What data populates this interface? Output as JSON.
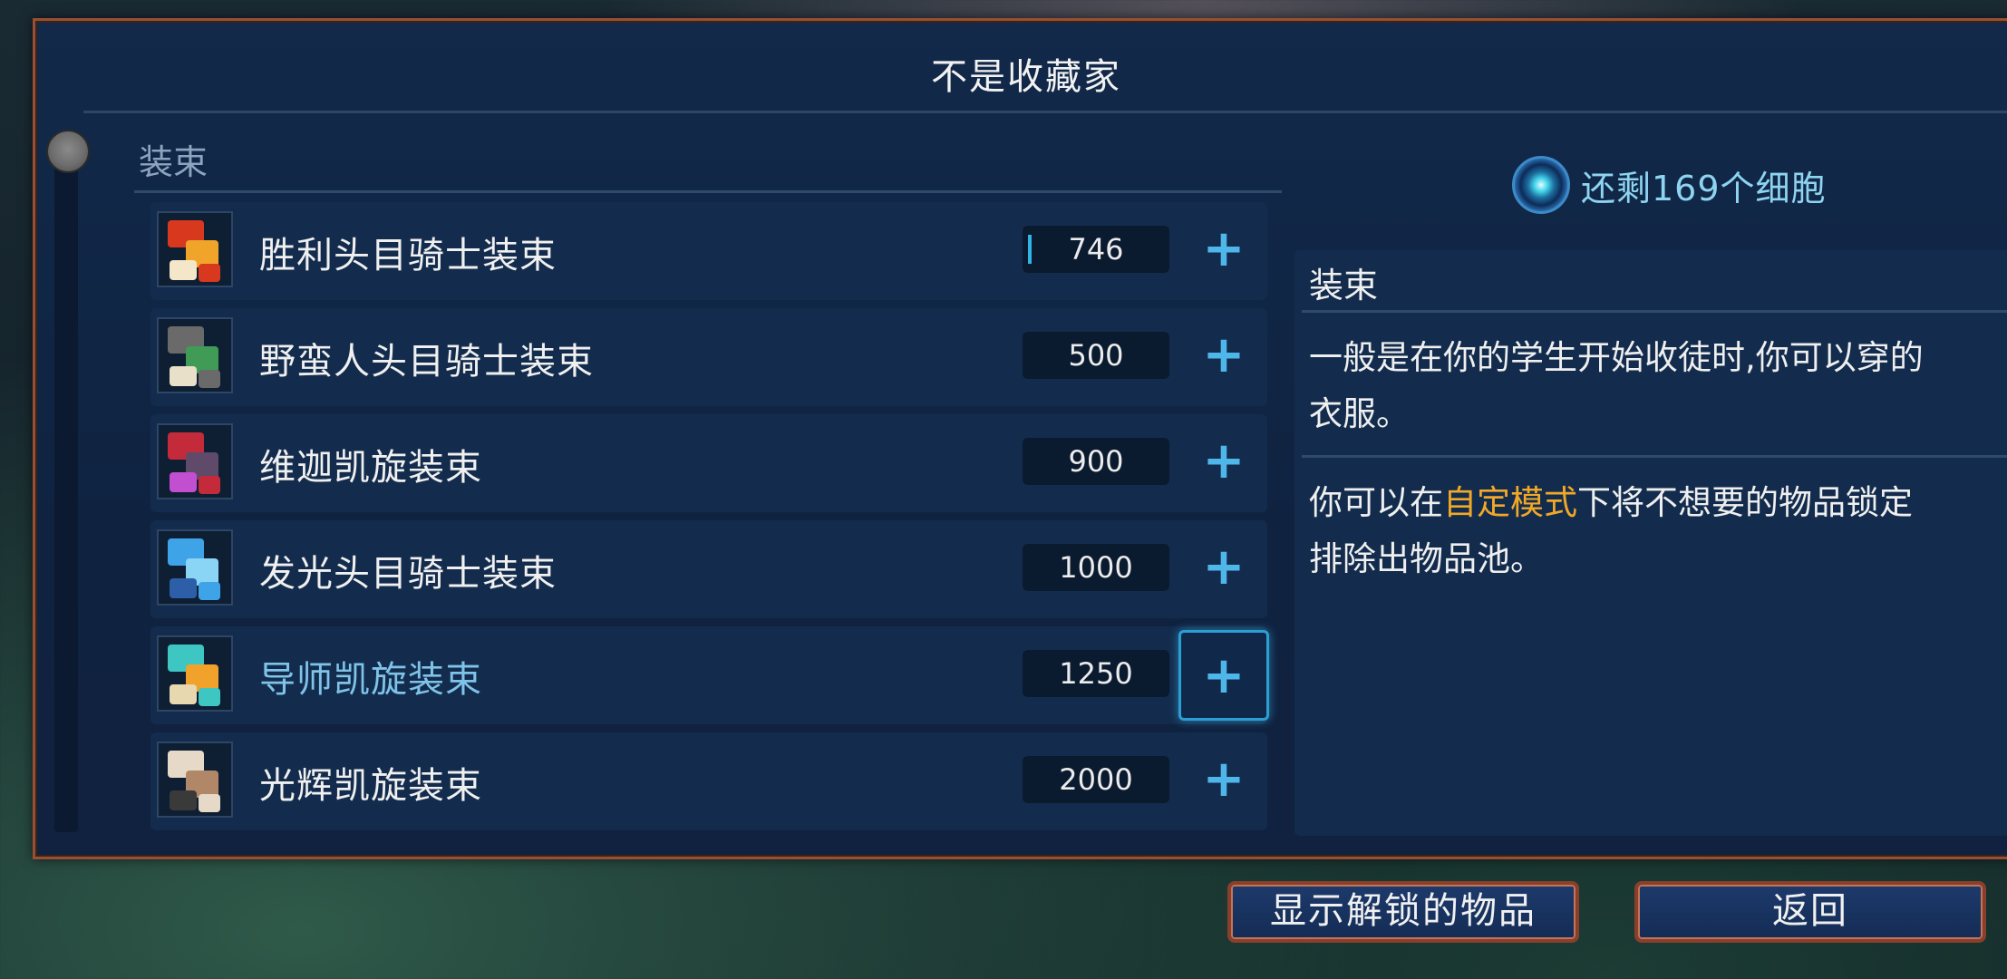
{
  "window": {
    "title": "不是收藏家"
  },
  "section": {
    "label": "装束"
  },
  "items": [
    {
      "name": "胜利头目骑士装束",
      "price": "746",
      "icon": "knight-outfit-icon",
      "colors": [
        "#d8391e",
        "#f0a52a",
        "#f4e6c8"
      ],
      "highlighted": false,
      "selected": false,
      "progress": true
    },
    {
      "name": "野蛮人头目骑士装束",
      "price": "500",
      "icon": "barbarian-outfit-icon",
      "colors": [
        "#6b6a6a",
        "#3f9b55",
        "#e8e0c8"
      ],
      "highlighted": false,
      "selected": false,
      "progress": false
    },
    {
      "name": "维迦凯旋装束",
      "price": "900",
      "icon": "vega-outfit-icon",
      "colors": [
        "#c42b3a",
        "#5f4a6a",
        "#c24fd0"
      ],
      "highlighted": false,
      "selected": false,
      "progress": false
    },
    {
      "name": "发光头目骑士装束",
      "price": "1000",
      "icon": "glowing-outfit-icon",
      "colors": [
        "#3fa3e8",
        "#8ad4f5",
        "#2c5fa8"
      ],
      "highlighted": false,
      "selected": false,
      "progress": false
    },
    {
      "name": "导师凯旋装束",
      "price": "1250",
      "icon": "mentor-outfit-icon",
      "colors": [
        "#3ec6c2",
        "#f0a22a",
        "#e8d8b0"
      ],
      "highlighted": true,
      "selected": true,
      "progress": false
    },
    {
      "name": "光辉凯旋装束",
      "price": "2000",
      "icon": "radiant-outfit-icon",
      "colors": [
        "#e6d9c8",
        "#b08868",
        "#3a3a3a"
      ],
      "highlighted": false,
      "selected": false,
      "progress": false
    }
  ],
  "plus_symbol": "+",
  "cells": {
    "text": "还剩169个细胞",
    "icon": "cell-icon"
  },
  "description": {
    "title": "装束",
    "line1": "一般是在你的学生开始收徒时,你可以穿的",
    "line2": "衣服。",
    "line3_pre": "你可以在",
    "line3_highlight": "自定模式",
    "line3_post": "下将不想要的物品锁定",
    "line4": "排除出物品池。"
  },
  "buttons": {
    "show_unlocked": "显示解锁的物品",
    "back": "返回"
  }
}
